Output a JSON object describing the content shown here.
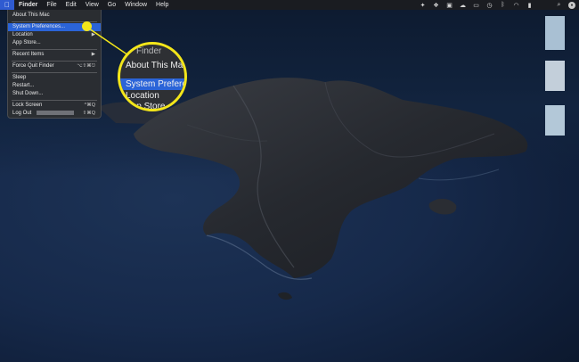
{
  "menubar": {
    "apple_icon": "apple-icon",
    "items": [
      {
        "label": "Finder",
        "bold": true
      },
      {
        "label": "File"
      },
      {
        "label": "Edit"
      },
      {
        "label": "View"
      },
      {
        "label": "Go"
      },
      {
        "label": "Window"
      },
      {
        "label": "Help"
      }
    ],
    "status_icons": [
      "star-icon",
      "dropbox-icon",
      "scan-icon",
      "cloud-icon",
      "display-icon",
      "time-machine-icon",
      "bluetooth-icon",
      "wifi-icon",
      "battery-icon",
      "search-icon",
      "user-icon"
    ]
  },
  "apple_menu": {
    "about": "About This Mac",
    "system_preferences": "System Preferences...",
    "location": "Location",
    "app_store": "App Store...",
    "recent_items": "Recent Items",
    "force_quit": "Force Quit Finder",
    "force_quit_shortcut": "⌥⇧⌘⎋",
    "sleep": "Sleep",
    "restart": "Restart...",
    "shut_down": "Shut Down...",
    "lock_screen": "Lock Screen",
    "lock_screen_shortcut": "^⌘Q",
    "log_out": "Log Out",
    "log_out_shortcut": "⇧⌘Q",
    "submenu_arrow": "▶"
  },
  "magnifier": {
    "line1": "Finder",
    "line2": "About This Mac",
    "line3": "System Preferen",
    "line4": "Location",
    "line5": "App Store...",
    "highlight_color": "#f3e61a"
  },
  "colors": {
    "accent": "#2b64d8",
    "callout": "#f3e61a"
  }
}
